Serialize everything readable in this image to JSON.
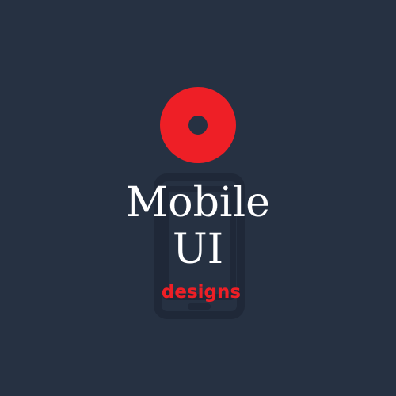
{
  "logo": {
    "title_line_1": "Mobile",
    "title_line_2": "UI",
    "tagline": "designs",
    "ring_icon": "pin-ring-icon",
    "phone_icon": "smartphone-icon"
  },
  "colors": {
    "background": "#263142",
    "accent": "#ee1f26",
    "text": "#ffffff",
    "phone_outline": "#1f2838"
  }
}
